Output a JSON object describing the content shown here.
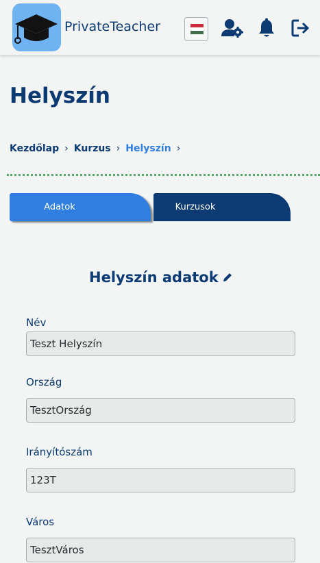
{
  "header": {
    "brand": "PrivateTeacher",
    "icons": [
      "graduation-cap-logo",
      "hungarian-flag",
      "user-settings-icon",
      "bell-icon",
      "logout-icon"
    ],
    "flag_colors": [
      "#cd2a3e",
      "#ffffff",
      "#436f4d"
    ]
  },
  "page": {
    "title": "Helyszín",
    "breadcrumb": [
      "Kezdőlap",
      "Kurzus",
      "Helyszín"
    ]
  },
  "tabs": [
    {
      "label": "Adatok",
      "active": true
    },
    {
      "label": "Kurzusok",
      "active": false
    }
  ],
  "form": {
    "title": "Helyszín adatok",
    "fields": [
      {
        "label": "Név",
        "value": "Teszt Helyszín"
      },
      {
        "label": "Ország",
        "value": "TesztOrszág"
      },
      {
        "label": "Irányítószám",
        "value": "123T"
      },
      {
        "label": "Város",
        "value": "TesztVáros"
      }
    ]
  },
  "colors": {
    "primary": "#0c3a73",
    "accent": "#2f7ee0",
    "divider": "#5aa66a"
  }
}
